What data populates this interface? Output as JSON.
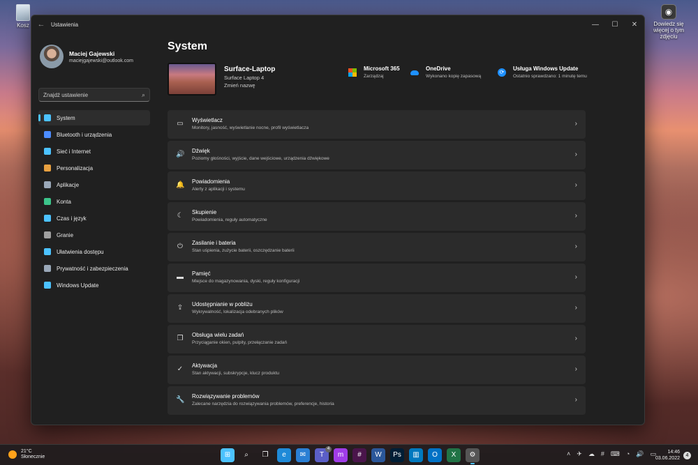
{
  "desktop": {
    "recycle_bin_label": "Kosz",
    "snip_label": "Dowiedz się więcej o tym zdjęciu"
  },
  "window": {
    "title": "Ustawienia",
    "back_glyph": "←",
    "minimize_glyph": "—",
    "maximize_glyph": "☐",
    "close_glyph": "✕"
  },
  "profile": {
    "name": "Maciej Gajewski",
    "email": "maciejgajewski@outlook.com"
  },
  "search": {
    "placeholder": "Znajdź ustawienie",
    "icon": "⌕"
  },
  "nav": [
    {
      "label": "System",
      "icon": "system-icon",
      "color": "#4cc2ff",
      "active": true
    },
    {
      "label": "Bluetooth i urządzenia",
      "icon": "bluetooth-icon",
      "color": "#4c8cff"
    },
    {
      "label": "Sieć i Internet",
      "icon": "wifi-icon",
      "color": "#4cc2ff"
    },
    {
      "label": "Personalizacja",
      "icon": "brush-icon",
      "color": "#e8a040"
    },
    {
      "label": "Aplikacje",
      "icon": "apps-icon",
      "color": "#9aa8b8"
    },
    {
      "label": "Konta",
      "icon": "account-icon",
      "color": "#3cc48a"
    },
    {
      "label": "Czas i język",
      "icon": "globe-clock-icon",
      "color": "#4cc2ff"
    },
    {
      "label": "Granie",
      "icon": "gamepad-icon",
      "color": "#a0a0a0"
    },
    {
      "label": "Ułatwienia dostępu",
      "icon": "accessibility-icon",
      "color": "#4cc2ff"
    },
    {
      "label": "Prywatność i zabezpieczenia",
      "icon": "shield-icon",
      "color": "#9aa8b8"
    },
    {
      "label": "Windows Update",
      "icon": "update-icon",
      "color": "#4cc2ff"
    }
  ],
  "main": {
    "title": "System",
    "device": {
      "name": "Surface-Laptop",
      "model": "Surface Laptop 4",
      "rename": "Zmień nazwę"
    },
    "services": [
      {
        "title": "Microsoft 365",
        "subtitle": "Zarządzaj",
        "icon": "microsoft365-icon"
      },
      {
        "title": "OneDrive",
        "subtitle": "Wykonano kopię zapasową",
        "icon": "onedrive-icon"
      },
      {
        "title": "Usługa Windows Update",
        "subtitle": "Ostatnio sprawdzano: 1 minutę temu",
        "icon": "windows-update-icon"
      }
    ],
    "rows": [
      {
        "title": "Wyświetlacz",
        "desc": "Monitory, jasność, wyświetlanie nocne, profil wyświetlacza",
        "icon": "display-icon",
        "glyph": "▭"
      },
      {
        "title": "Dźwięk",
        "desc": "Poziomy głośności, wyjście, dane wejściowe, urządzenia dźwiękowe",
        "icon": "speaker-icon",
        "glyph": "🔊"
      },
      {
        "title": "Powiadomienia",
        "desc": "Alerty z aplikacji i systemu",
        "icon": "bell-icon",
        "glyph": "🔔"
      },
      {
        "title": "Skupienie",
        "desc": "Powiadomienia, reguły automatyczne",
        "icon": "moon-icon",
        "glyph": "☾"
      },
      {
        "title": "Zasilanie i bateria",
        "desc": "Stan uśpienia, zużycie baterii, oszczędzanie baterii",
        "icon": "power-icon",
        "glyph": "⏻"
      },
      {
        "title": "Pamięć",
        "desc": "Miejsce do magazynowania, dyski, reguły konfiguracji",
        "icon": "storage-icon",
        "glyph": "▬"
      },
      {
        "title": "Udostępnianie w pobliżu",
        "desc": "Wykrywalność, lokalizacja odebranych plików",
        "icon": "share-icon",
        "glyph": "⇪"
      },
      {
        "title": "Obsługa wielu zadań",
        "desc": "Przyciąganie okien, pulpity, przełączanie zadań",
        "icon": "multitask-icon",
        "glyph": "❐"
      },
      {
        "title": "Aktywacja",
        "desc": "Stan aktywacji, subskrypcje, klucz produktu",
        "icon": "check-circle-icon",
        "glyph": "✓"
      },
      {
        "title": "Rozwiązywanie problemów",
        "desc": "Zalecane narzędzia do rozwiązywania problemów, preferencje, historia",
        "icon": "wrench-icon",
        "glyph": "🔧"
      }
    ],
    "chevron": "›"
  },
  "taskbar": {
    "weather_temp": "21°C",
    "weather_desc": "Słonecznie",
    "apps": [
      {
        "name": "start-icon",
        "glyph": "⊞",
        "color": "#4cc2ff"
      },
      {
        "name": "search-icon",
        "glyph": "⌕",
        "color": "transparent"
      },
      {
        "name": "task-view-icon",
        "glyph": "❐",
        "color": "transparent"
      },
      {
        "name": "edge-icon",
        "glyph": "e",
        "color": "#1f8ad8"
      },
      {
        "name": "mail-icon",
        "glyph": "✉",
        "color": "#2a7fd4"
      },
      {
        "name": "teams-icon",
        "glyph": "T",
        "color": "#5b5fc7",
        "badge": "4"
      },
      {
        "name": "messenger-icon",
        "glyph": "m",
        "color": "#a03ce8"
      },
      {
        "name": "slack-icon",
        "glyph": "#",
        "color": "#4a154b"
      },
      {
        "name": "word-icon",
        "glyph": "W",
        "color": "#2b579a"
      },
      {
        "name": "photoshop-icon",
        "glyph": "Ps",
        "color": "#001e36"
      },
      {
        "name": "trello-icon",
        "glyph": "▥",
        "color": "#0079bf"
      },
      {
        "name": "outlook-icon",
        "glyph": "O",
        "color": "#0072c6"
      },
      {
        "name": "excel-icon",
        "glyph": "X",
        "color": "#217346"
      },
      {
        "name": "settings-app-icon",
        "glyph": "⚙",
        "color": "#555",
        "active": true
      }
    ],
    "tray_glyphs": [
      "˄",
      "✈",
      "☁",
      "#",
      "⌨",
      "◔",
      "🔊",
      "▭"
    ],
    "time": "14:46",
    "date": "03.06.2022",
    "notifications": "4"
  }
}
